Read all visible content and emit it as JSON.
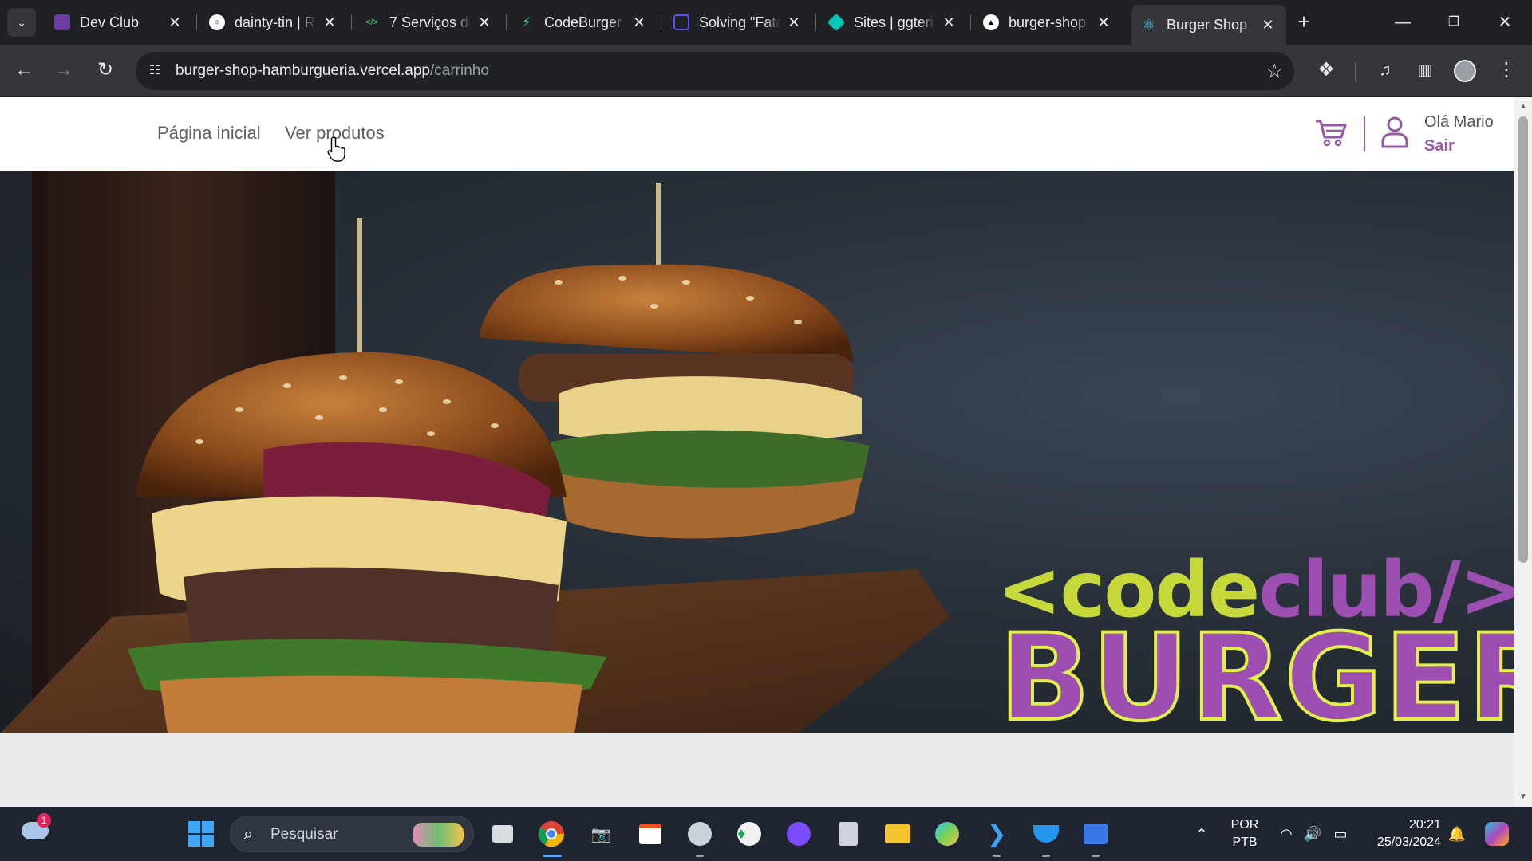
{
  "browser": {
    "tabs": [
      {
        "title": "Dev Club",
        "favicon_color": "#6b3fa0",
        "active": false
      },
      {
        "title": "dainty-tin | R",
        "favicon_color": "#ffffff",
        "active": false
      },
      {
        "title": "7 Serviços de",
        "favicon_color": "#2aa34a",
        "active": false
      },
      {
        "title": "CodeBurger",
        "favicon_color": "#3ddc84",
        "active": false
      },
      {
        "title": "Solving \"Fata",
        "favicon_color": "#5a4fff",
        "active": false
      },
      {
        "title": "Sites | ggteri",
        "favicon_color": "#00c7b7",
        "active": false
      },
      {
        "title": "burger-shop",
        "favicon_color": "#ffffff",
        "active": false
      },
      {
        "title": "Burger Shop",
        "favicon_color": "#61dafb",
        "active": true
      }
    ],
    "url_host": "burger-shop-hamburgueria.vercel.app",
    "url_path": "/carrinho"
  },
  "site": {
    "nav": {
      "home": "Página inicial",
      "products": "Ver produtos"
    },
    "user": {
      "greeting": "Olá Mario",
      "logout": "Sair"
    },
    "accent_color": "#9758a6",
    "hero": {
      "logo_code_part1": "<code",
      "logo_code_part2": "club/>",
      "logo_burger": "BURGER"
    }
  },
  "taskbar": {
    "search_placeholder": "Pesquisar",
    "weather_badge": "1",
    "language_top": "POR",
    "language_bottom": "PTB",
    "time": "20:21",
    "date": "25/03/2024"
  }
}
